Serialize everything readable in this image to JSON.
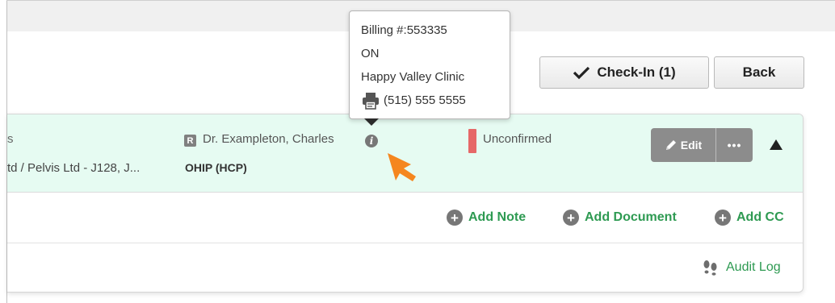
{
  "header": {
    "checkin_label": "Check-In (1)",
    "back_label": "Back"
  },
  "appointment": {
    "name_fragment": "s",
    "reason_fragment": "td / Pelvis Ltd - J128, J...",
    "referral_badge": "R",
    "doctor": "Dr. Exampleton, Charles",
    "info_icon_glyph": "i",
    "coverage": "OHIP (HCP)",
    "status": "Unconfirmed",
    "status_color": "#e66868",
    "edit_label": "Edit",
    "more_label": "•••"
  },
  "tooltip": {
    "billing": "Billing #:553335",
    "province": "ON",
    "clinic": "Happy Valley Clinic",
    "phone": "(515) 555 5555"
  },
  "actions": {
    "plus_glyph": "+",
    "add_note": "Add Note",
    "add_document": "Add Document",
    "add_cc": "Add CC"
  },
  "audit": {
    "label": "Audit Log"
  },
  "colors": {
    "accent_green": "#2e9a52",
    "header_bg": "#e6fbf2",
    "cursor_orange": "#f5861f"
  }
}
